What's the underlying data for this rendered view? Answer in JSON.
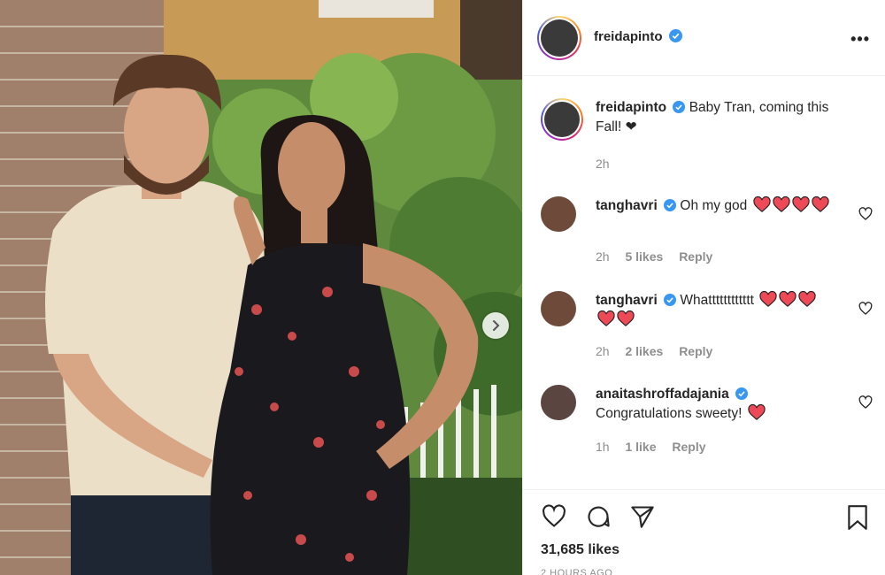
{
  "post": {
    "author": "freidapinto",
    "caption_text": "Baby Tran, coming this Fall! ❤",
    "caption_time": "2h",
    "likes": "31,685 likes",
    "time_ago": "2 HOURS AGO"
  },
  "comments": [
    {
      "user": "tanghavri",
      "text": "Oh my god",
      "hearts": 4,
      "time": "2h",
      "likes": "5 likes",
      "reply": "Reply"
    },
    {
      "user": "tanghavri",
      "text": "Whatttttttttttt",
      "hearts": 5,
      "time": "2h",
      "likes": "2 likes",
      "reply": "Reply"
    },
    {
      "user": "anaitashroffadajania",
      "text": "Congratulations sweety!",
      "hearts": 1,
      "time": "1h",
      "likes": "1 like",
      "reply": "Reply"
    }
  ],
  "icons": {
    "more": "more-options-icon",
    "verified": "verified-badge-icon",
    "like": "heart-icon",
    "comment": "comment-icon",
    "share": "share-icon",
    "save": "bookmark-icon",
    "next": "chevron-right-icon"
  },
  "colors": {
    "verified": "#3897f0",
    "heart_red": "#ed4956",
    "muted": "#8e8e8e"
  }
}
